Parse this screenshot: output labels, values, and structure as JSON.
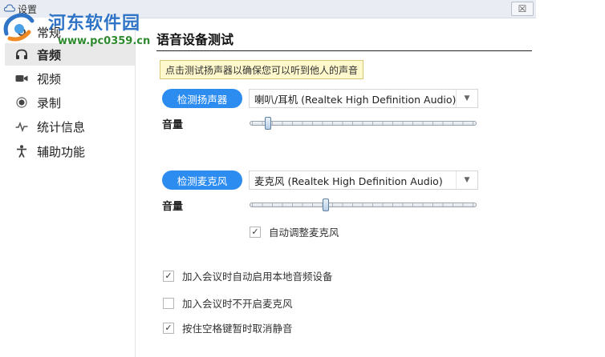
{
  "window": {
    "title": "设置",
    "close_symbol": "☒"
  },
  "watermark": {
    "text": "河东软件园",
    "url": "www.pc0359.cn"
  },
  "sidebar": {
    "items": [
      {
        "label": "常规",
        "icon": "gear-icon",
        "active": false
      },
      {
        "label": "音频",
        "icon": "headphone-icon",
        "active": true
      },
      {
        "label": "视频",
        "icon": "video-camera-icon",
        "active": false
      },
      {
        "label": "录制",
        "icon": "record-icon",
        "active": false
      },
      {
        "label": "统计信息",
        "icon": "pulse-icon",
        "active": false
      },
      {
        "label": "辅助功能",
        "icon": "accessibility-icon",
        "active": false
      }
    ]
  },
  "main": {
    "title": "语音设备测试",
    "speaker": {
      "tooltip": "点击测试扬声器以确保您可以听到他人的声音",
      "button": "检测扬声器",
      "device": "喇叭/耳机 (Realtek High Definition Audio)",
      "volume_label": "音量",
      "volume_level": 0.07
    },
    "microphone": {
      "button": "检测麦克风",
      "device": "麦克风 (Realtek High Definition Audio)",
      "volume_label": "音量",
      "volume_level": 0.33,
      "auto_adjust": {
        "label": "自动调整麦克风",
        "checked": true
      }
    },
    "options": [
      {
        "label": "加入会议时自动启用本地音频设备",
        "checked": true
      },
      {
        "label": "加入会议时不开启麦克风",
        "checked": false
      },
      {
        "label": "按住空格键暂时取消静音",
        "checked": true
      }
    ]
  }
}
